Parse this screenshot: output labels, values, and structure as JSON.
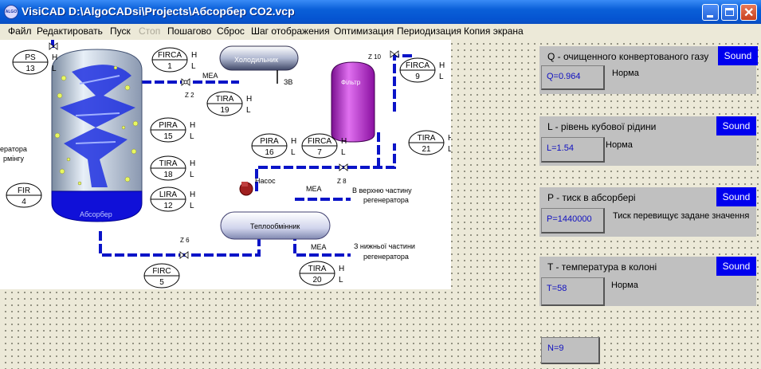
{
  "window": {
    "title": "VisiCAD D:\\AlgoCADsi\\Projects\\Абсорбер CO2.vcp",
    "app_icon": "ALGO"
  },
  "menu": [
    "Файл",
    "Редактировать",
    "Пуск",
    "Стоп",
    "Пошагово",
    "Сброс",
    "Шаг отображения",
    "Оптимизация",
    "Периодизация",
    "Копия экрана"
  ],
  "menu_disabled": [
    "Стоп"
  ],
  "diagram": {
    "absorber": "Абсорбер",
    "cooler": "Холодильник",
    "filter": "Фільтр",
    "pump": "Насос",
    "heat_exchanger": "Теплообмінник",
    "mea1": "МЕА",
    "mea2": "МЕА",
    "mea3": "МЕА",
    "zv": "ЗВ",
    "to_upper": "В верхню частину",
    "to_upper2": "регенератора",
    "from_lower": "З нижньої частини",
    "from_lower2": "регенератора",
    "left_text1": "ератора",
    "left_text2": "рмінгу",
    "valves": {
      "z2": "Z 2",
      "z10": "Z 10",
      "z8": "Z 8",
      "z6": "Z 6"
    },
    "instruments": [
      {
        "id": "ps13",
        "tag": "PS",
        "num": "13",
        "h": "H",
        "l": "L"
      },
      {
        "id": "firca1",
        "tag": "FIRCA",
        "num": "1",
        "h": "H",
        "l": "L"
      },
      {
        "id": "tira19",
        "tag": "TIRA",
        "num": "19",
        "h": "H",
        "l": "L"
      },
      {
        "id": "pira15",
        "tag": "PIRA",
        "num": "15",
        "h": "H",
        "l": "L"
      },
      {
        "id": "tira18",
        "tag": "TIRA",
        "num": "18",
        "h": "H",
        "l": "L"
      },
      {
        "id": "lira12",
        "tag": "LIRA",
        "num": "12",
        "h": "H",
        "l": "L"
      },
      {
        "id": "fir4",
        "tag": "FIR",
        "num": "4",
        "h": "",
        "l": ""
      },
      {
        "id": "pira16",
        "tag": "PIRA",
        "num": "16",
        "h": "H",
        "l": "L"
      },
      {
        "id": "firca7",
        "tag": "FIRCA",
        "num": "7",
        "h": "H",
        "l": "L"
      },
      {
        "id": "firca9",
        "tag": "FIRCA",
        "num": "9",
        "h": "H",
        "l": "L"
      },
      {
        "id": "tira21",
        "tag": "TIRA",
        "num": "21",
        "h": "H",
        "l": "L"
      },
      {
        "id": "firc5",
        "tag": "FIRC",
        "num": "5",
        "h": "",
        "l": ""
      },
      {
        "id": "tira20",
        "tag": "TIRA",
        "num": "20",
        "h": "H",
        "l": "L"
      }
    ]
  },
  "panels": [
    {
      "title": "Q - очищенного конвертованого газу",
      "sound": "Sound",
      "value": "Q=0.964",
      "status": "Норма"
    },
    {
      "title": "L - рівень кубової рідини",
      "sound": "Sound",
      "value": "L=1.54",
      "status": "Норма"
    },
    {
      "title": "P - тиск в абсорбері",
      "sound": "Sound",
      "value": "P=1440000",
      "status": "Тиск перевищує задане значення"
    },
    {
      "title": "T - температура в колоні",
      "sound": "Sound",
      "value": "T=58",
      "status": "Норма"
    }
  ],
  "counter": {
    "value": "N=9"
  },
  "colors": {
    "title_bar": "#0554d1",
    "sound_button": "#0000ee",
    "panel": "#c0c0c0",
    "pipe": "#0a14c8",
    "value_text": "#1010c0"
  }
}
